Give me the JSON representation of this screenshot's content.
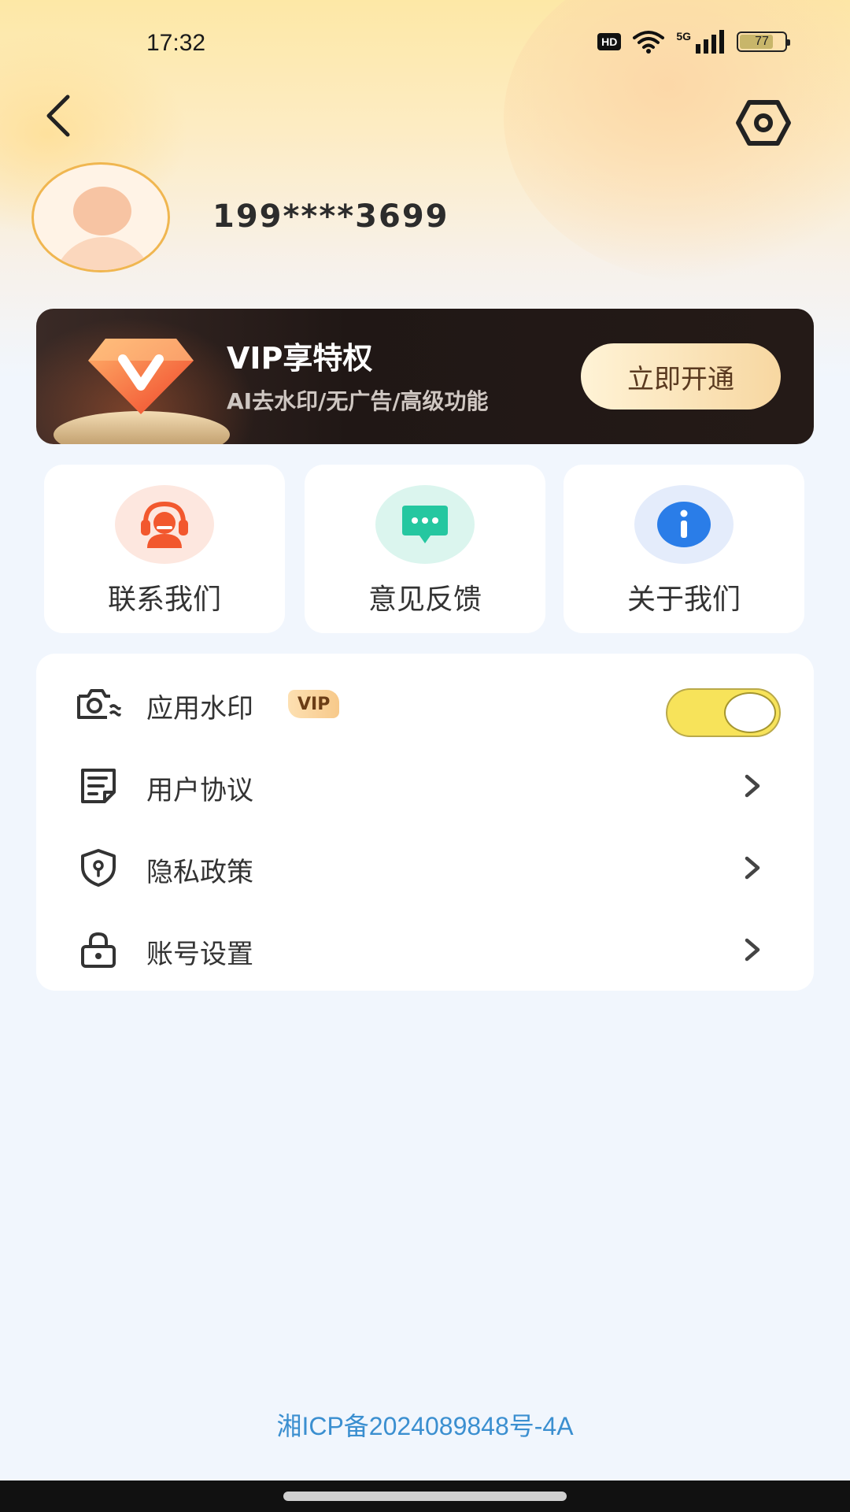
{
  "status_bar": {
    "time": "17:32",
    "hd": "HD",
    "network": "5G",
    "battery": "77",
    "battery_level": 0.77
  },
  "header": {
    "back_icon": "chevron-left-icon",
    "settings_icon": "hexagon-settings-icon"
  },
  "profile": {
    "phone": "199****3699"
  },
  "vip_banner": {
    "title": "VIP享特权",
    "subtitle": "AI去水印/无广告/高级功能",
    "button": "立即开通"
  },
  "quick_actions": [
    {
      "label": "联系我们",
      "icon": "customer-service-icon",
      "color": "#f2582e"
    },
    {
      "label": "意见反馈",
      "icon": "chat-bubble-icon",
      "color": "#25c7a0"
    },
    {
      "label": "关于我们",
      "icon": "info-icon",
      "color": "#2a7de8"
    }
  ],
  "menu": {
    "watermark": {
      "label": "应用水印",
      "tag": "VIP",
      "enabled": true
    },
    "items": [
      {
        "label": "用户协议",
        "icon": "document-icon"
      },
      {
        "label": "隐私政策",
        "icon": "shield-icon"
      },
      {
        "label": "账号设置",
        "icon": "lock-icon"
      }
    ]
  },
  "footer": {
    "icp": "湘ICP备2024089848号-4A"
  }
}
